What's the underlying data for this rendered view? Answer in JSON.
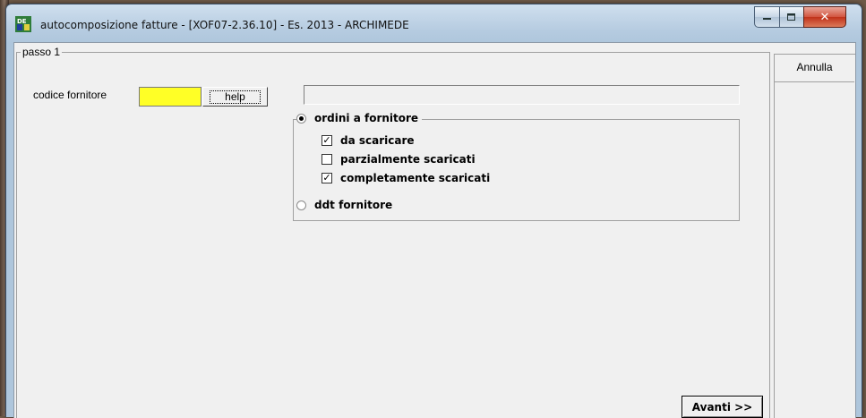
{
  "window": {
    "title": "autocomposizione fatture - [XOF07-2.36.10] - Es. 2013 - ARCHIMEDE",
    "controls": {
      "minimize": "minimize-icon",
      "maximize": "maximize-icon",
      "close": "close-icon"
    }
  },
  "step": {
    "label": "passo 1"
  },
  "supplier": {
    "label": "codice fornitore",
    "code_value": "",
    "help_label": "help",
    "description_value": ""
  },
  "source": {
    "ordini": {
      "label": "ordini a fornitore",
      "selected": true
    },
    "filters": [
      {
        "label": "da scaricare",
        "checked": true
      },
      {
        "label": "parzialmente scaricati",
        "checked": false
      },
      {
        "label": "completamente scaricati",
        "checked": true
      }
    ],
    "ddt": {
      "label": "ddt fornitore",
      "selected": false
    }
  },
  "actions": {
    "cancel_label": "Annulla",
    "next_label": "Avanti >>"
  },
  "colors": {
    "code_field_bg": "#ffff26",
    "face": "#f0f0f0"
  }
}
